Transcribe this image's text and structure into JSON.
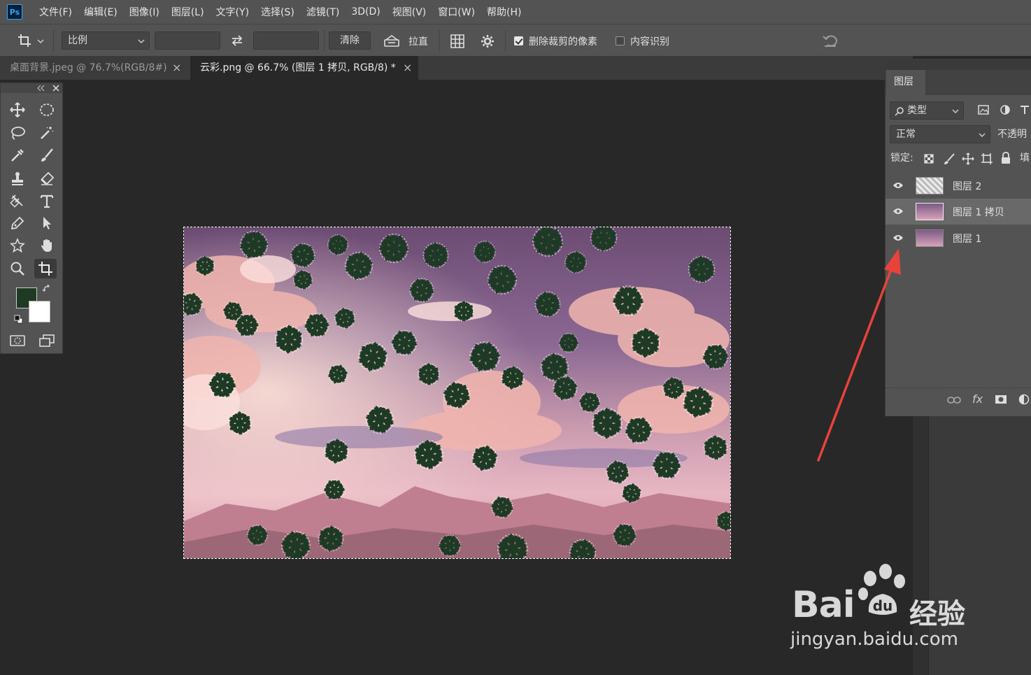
{
  "app": {
    "logo_text": "Ps"
  },
  "menu": [
    "文件(F)",
    "编辑(E)",
    "图像(I)",
    "图层(L)",
    "文字(Y)",
    "选择(S)",
    "滤镜(T)",
    "3D(D)",
    "视图(V)",
    "窗口(W)",
    "帮助(H)"
  ],
  "options": {
    "ratio_label": "比例",
    "clear_label": "清除",
    "straighten_label": "拉直",
    "delete_cropped_label": "删除裁剪的像素",
    "delete_cropped_checked": true,
    "content_aware_label": "内容识别",
    "content_aware_checked": false
  },
  "tabs": [
    {
      "label": "桌面背景.jpeg @ 76.7%(RGB/8#)",
      "close": "×",
      "active": false
    },
    {
      "label": "云彩.png @ 66.7% (图层 1 拷贝, RGB/8) *",
      "close": "×",
      "active": true
    }
  ],
  "colors": {
    "foreground": "#1f3a22",
    "background": "#ffffff",
    "accent": "#e8433b"
  },
  "layers_panel": {
    "tab_label": "图层",
    "filter_label": "类型",
    "blend_mode": "正常",
    "opacity_label": "不透明",
    "lock_label": "锁定:",
    "fill_label": "填",
    "layers": [
      {
        "name": "图层 2",
        "visible": true,
        "selected": false
      },
      {
        "name": "图层 1 拷贝",
        "visible": true,
        "selected": true
      },
      {
        "name": "图层 1",
        "visible": true,
        "selected": false
      }
    ],
    "footer_fx": "fx"
  },
  "watermark": {
    "logo": "Bai",
    "logo_suffix": "经验",
    "url": "jingyan.baidu.com"
  }
}
